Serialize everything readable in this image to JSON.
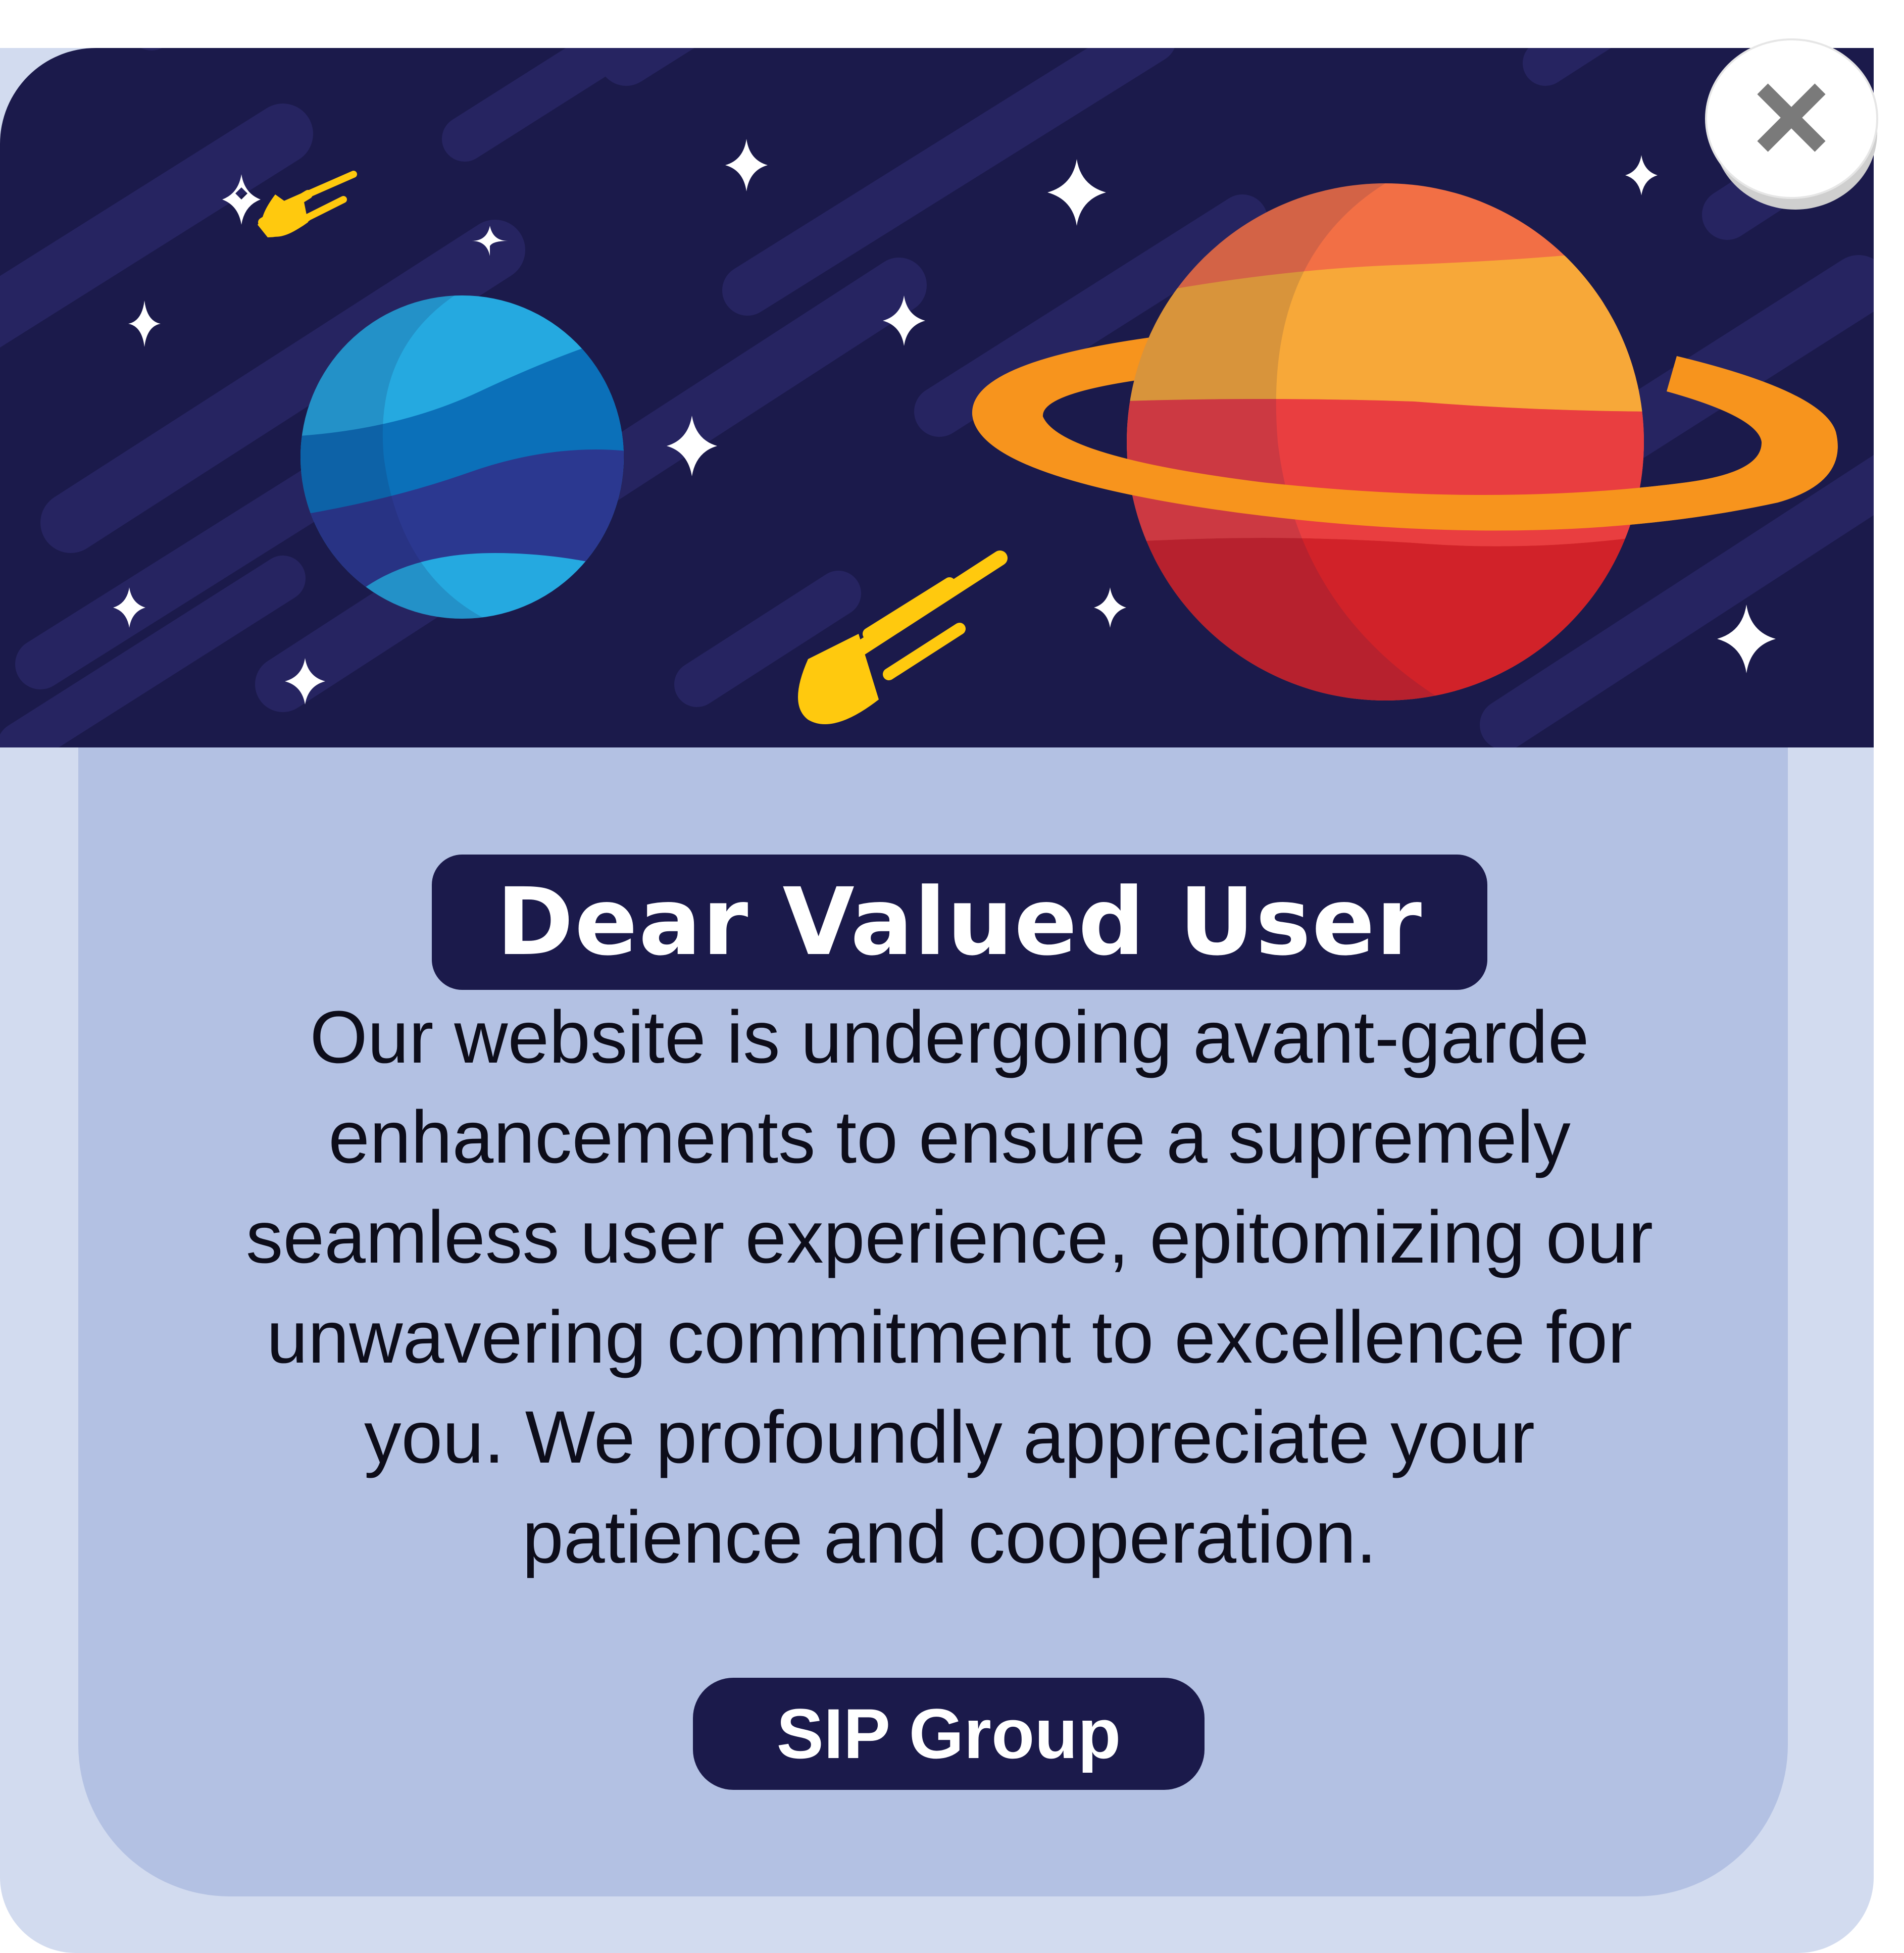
{
  "dialog": {
    "title": "Dear Valued User",
    "message_lines": [
      "Our website is undergoing avant-garde",
      "enhancements to ensure a supremely",
      "seamless user experience, epitomizing our",
      "unwavering commitment to excellence for",
      "you. We profoundly appreciate your",
      "patience and cooperation."
    ],
    "signature": "SIP Group",
    "close_icon": "close-x-icon"
  },
  "banner": {
    "illustration": "space-scene",
    "elements": [
      "blue-planet",
      "ringed-planet",
      "comet",
      "comet",
      "stars"
    ]
  },
  "colors": {
    "banner_background": "#1b1a4b",
    "pill_background": "#1b1a4b",
    "panel_inner": "#b3c1e3",
    "panel_outer": "#d2dbef",
    "blue_planet": "#25a9e0",
    "orange_planet": "#f26f45",
    "ring": "#f7941d",
    "comet": "#ffc90e"
  }
}
